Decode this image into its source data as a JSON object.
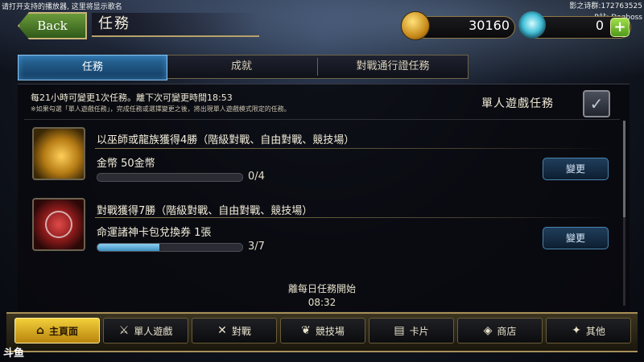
{
  "overlay": {
    "broadcast_note": "请打开支持的播放器, 这里将显示歌名",
    "stream_group": "影之诗群:172763525",
    "stream_user": "B站: Dogboss"
  },
  "header": {
    "back_label": "Back",
    "title": "任務",
    "gold": "30160",
    "crystals": "0",
    "plus": "+"
  },
  "tabs": [
    {
      "label": "任務",
      "active": true
    },
    {
      "label": "成就",
      "active": false
    },
    {
      "label": "對戰通行證任務",
      "active": false
    }
  ],
  "notice": {
    "main": "每21小時可變更1次任務。離下次可變更時間18:53",
    "sub": "※如果勾選「單人遊戲任務」，完成任務或選擇變更之後，將出現單人遊戲模式限定的任務。"
  },
  "solo_toggle": {
    "label": "單人遊戲任務",
    "checked": true
  },
  "quests": [
    {
      "title": "以巫師或龍族獲得4勝（階級對戰、自由對戰、競技場）",
      "reward": "金幣 50金幣",
      "progress_text": "0/4",
      "progress": 0.0,
      "change_label": "變更"
    },
    {
      "title": "對戰獲得7勝（階級對戰、自由對戰、競技場）",
      "reward": "命運諸神卡包兌換券 1張",
      "progress_text": "3/7",
      "progress": 0.4286,
      "change_label": "變更"
    }
  ],
  "daily": {
    "label": "離每日任務開始",
    "time": "08:32"
  },
  "nav": [
    {
      "label": "主頁面",
      "icon": "home-icon",
      "glyph": "⌂",
      "active": true
    },
    {
      "label": "單人遊戲",
      "icon": "sword-icon",
      "glyph": "⚔",
      "active": false
    },
    {
      "label": "對戰",
      "icon": "crossed-swords-icon",
      "glyph": "✕",
      "active": false
    },
    {
      "label": "競技場",
      "icon": "laurel-icon",
      "glyph": "❦",
      "active": false
    },
    {
      "label": "卡片",
      "icon": "cards-icon",
      "glyph": "▤",
      "active": false
    },
    {
      "label": "商店",
      "icon": "shop-icon",
      "glyph": "◈",
      "active": false
    },
    {
      "label": "其他",
      "icon": "more-icon",
      "glyph": "✦",
      "active": false
    }
  ],
  "logo": "斗鱼"
}
